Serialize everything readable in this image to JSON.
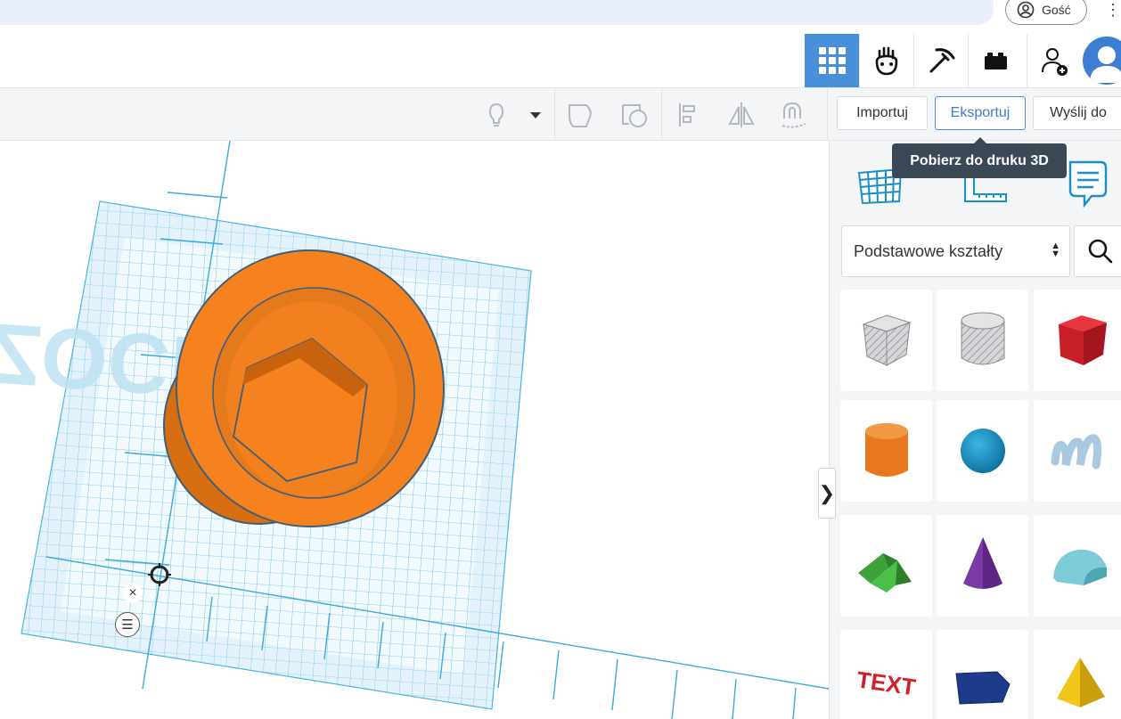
{
  "browser": {
    "guest_label": "Gość",
    "menu_glyph": "⋮"
  },
  "header": {
    "buttons": [
      {
        "name": "3d-design-icon",
        "active": true
      },
      {
        "name": "circuits-icon",
        "active": false
      },
      {
        "name": "codeblocks-icon",
        "active": false
      },
      {
        "name": "bricks-icon",
        "active": false
      },
      {
        "name": "add-user-icon",
        "active": false
      }
    ]
  },
  "toolbar": {
    "import_label": "Importuj",
    "export_label": "Eksportuj",
    "send_label": "Wyślij do"
  },
  "tooltip": {
    "text": "Pobierz do druku 3D"
  },
  "workplane": {
    "snap_glyph": "×",
    "menu_glyph": "☰",
    "collapse_glyph": "❯",
    "watermark_text": "ZOCK"
  },
  "side_panel": {
    "category_selected": "Podstawowe kształty",
    "shapes": [
      {
        "name": "box-hole",
        "color": "#c8c9cc"
      },
      {
        "name": "cylinder-hole",
        "color": "#c8c9cc"
      },
      {
        "name": "box",
        "color": "#d2202a"
      },
      {
        "name": "cylinder",
        "color": "#e8781e"
      },
      {
        "name": "sphere",
        "color": "#1b95c8"
      },
      {
        "name": "scribble",
        "color": "#a8c9e0"
      },
      {
        "name": "roof",
        "color": "#3da23c"
      },
      {
        "name": "cone",
        "color": "#7a3aa3"
      },
      {
        "name": "round-roof",
        "color": "#7ccbd6"
      },
      {
        "name": "text",
        "color": "#d2202a"
      },
      {
        "name": "polygon",
        "color": "#1e3a8a"
      },
      {
        "name": "pyramid",
        "color": "#f0c419"
      }
    ]
  },
  "colors": {
    "accent": "#4a8fd9",
    "grid": "#4ab3e0",
    "shape_orange": "#f5821f"
  }
}
